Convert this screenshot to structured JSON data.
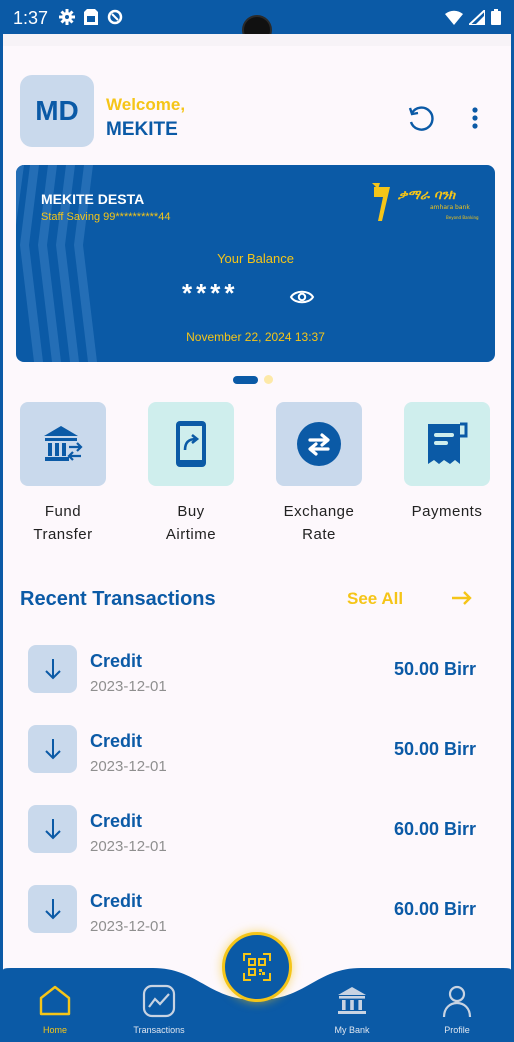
{
  "status": {
    "time": "1:37"
  },
  "header": {
    "avatar": "MD",
    "welcome": "Welcome,",
    "name": "MEKITE"
  },
  "card": {
    "holder": "MEKITE DESTA",
    "account": "Staff Saving 99**********44",
    "logo_text": "ቃማራ ባንክ",
    "logo_subtext": "amhara bank",
    "logo_tagline": "Beyond Banking",
    "balance_label": "Your Balance",
    "balance": "****",
    "date": "November 22, 2024 13:37"
  },
  "quick_actions": [
    {
      "label_line1": "Fund",
      "label_line2": "Transfer",
      "icon": "bank-transfer-icon"
    },
    {
      "label_line1": "Buy",
      "label_line2": "Airtime",
      "icon": "phone-share-icon"
    },
    {
      "label_line1": "Exchange",
      "label_line2": "Rate",
      "icon": "exchange-icon"
    },
    {
      "label_line1": "Payments",
      "label_line2": "",
      "icon": "receipt-icon"
    }
  ],
  "recent": {
    "title": "Recent Transactions",
    "see_all": "See All",
    "items": [
      {
        "type": "Credit",
        "date": "2023-12-01",
        "amount": "50.00 Birr"
      },
      {
        "type": "Credit",
        "date": "2023-12-01",
        "amount": "50.00 Birr"
      },
      {
        "type": "Credit",
        "date": "2023-12-01",
        "amount": "60.00 Birr"
      },
      {
        "type": "Credit",
        "date": "2023-12-01",
        "amount": "60.00 Birr"
      }
    ]
  },
  "nav": {
    "home": "Home",
    "transactions": "Transactions",
    "mybank": "My Bank",
    "profile": "Profile"
  },
  "colors": {
    "primary": "#0b5aa6",
    "accent": "#f5c518",
    "tile_blue": "#c9d9ec",
    "tile_teal": "#cfeeed"
  }
}
